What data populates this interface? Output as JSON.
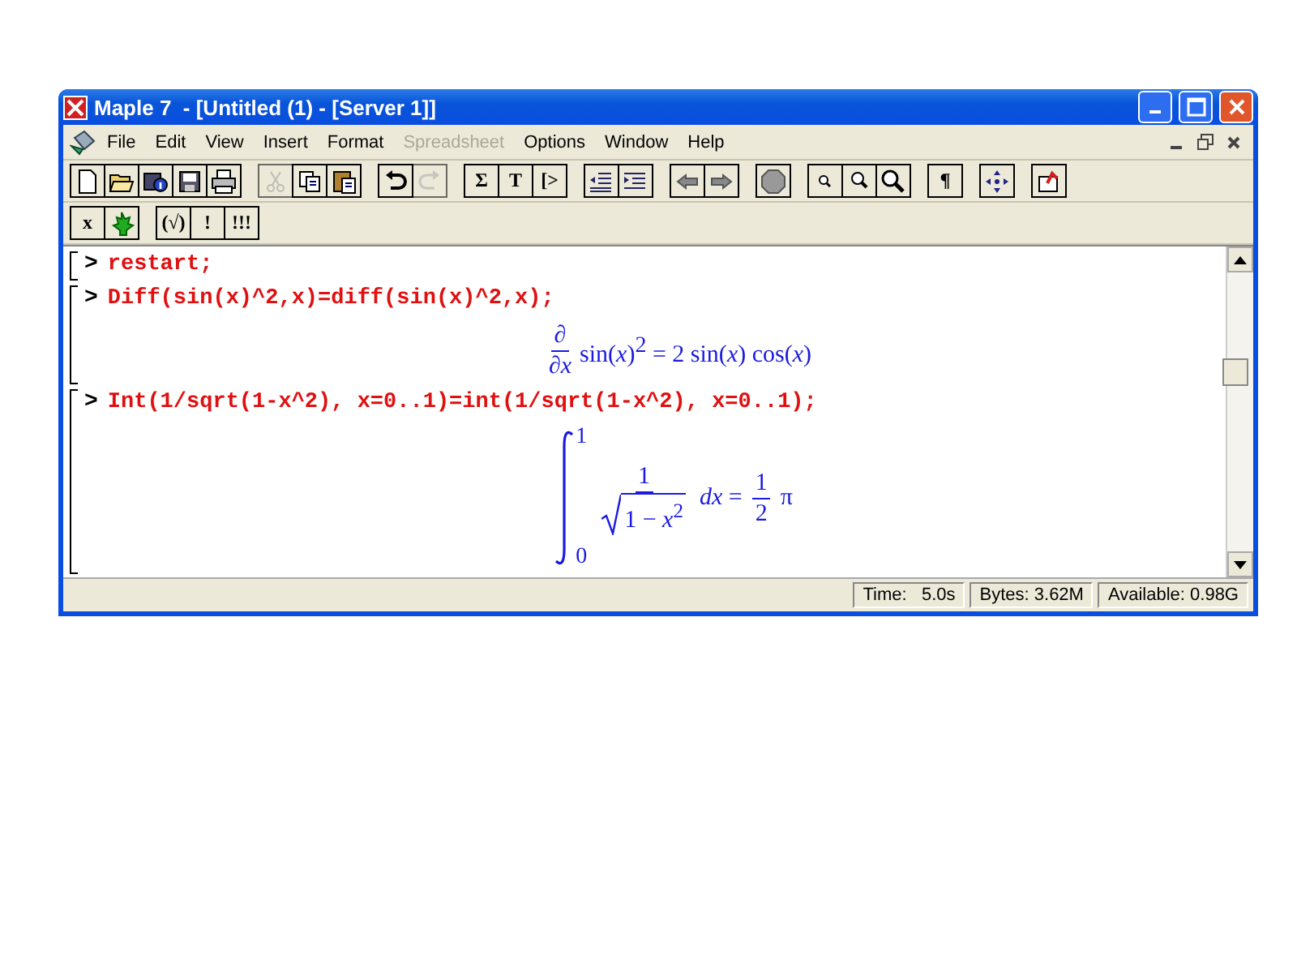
{
  "window": {
    "title": "Maple 7  - [Untitled (1) - [Server 1]]"
  },
  "menu": [
    {
      "label": "File",
      "disabled": false
    },
    {
      "label": "Edit",
      "disabled": false
    },
    {
      "label": "View",
      "disabled": false
    },
    {
      "label": "Insert",
      "disabled": false
    },
    {
      "label": "Format",
      "disabled": false
    },
    {
      "label": "Spreadsheet",
      "disabled": true
    },
    {
      "label": "Options",
      "disabled": false
    },
    {
      "label": "Window",
      "disabled": false
    },
    {
      "label": "Help",
      "disabled": false
    }
  ],
  "toolbar": [
    [
      {
        "disabled": false
      },
      {
        "disabled": false
      },
      {
        "disabled": false
      },
      {
        "disabled": false
      },
      {
        "disabled": false
      }
    ],
    [
      {
        "disabled": true
      },
      {
        "disabled": false
      },
      {
        "disabled": false
      }
    ],
    [
      {
        "disabled": false
      },
      {
        "disabled": true
      }
    ],
    [
      {
        "label": "Σ",
        "disabled": false
      },
      {
        "label": "T",
        "disabled": false
      },
      {
        "label": "[>",
        "disabled": false
      }
    ],
    [
      {
        "disabled": false
      },
      {
        "disabled": false
      }
    ],
    [
      {
        "disabled": false
      },
      {
        "disabled": false
      }
    ],
    [
      {
        "disabled": false
      }
    ],
    [
      {
        "disabled": false
      },
      {
        "disabled": false
      },
      {
        "disabled": false
      }
    ],
    [
      {
        "label": "¶",
        "disabled": false
      }
    ],
    [
      {
        "disabled": false
      }
    ],
    [
      {
        "disabled": false
      }
    ]
  ],
  "context_toolbar": [
    [
      {
        "label": "x",
        "disabled": false
      },
      {
        "disabled": false
      }
    ],
    [
      {
        "label": "(√)",
        "disabled": false
      },
      {
        "label": "!",
        "disabled": false
      },
      {
        "label": "!!!",
        "disabled": false
      }
    ]
  ],
  "worksheet": [
    {
      "prompt": ">",
      "input": "restart;"
    },
    {
      "prompt": ">",
      "input": "Diff(sin(x)^2,x)=diff(sin(x)^2,x);",
      "output": {
        "kind": "derivative",
        "numerator": "∂",
        "denominator": "∂*x*",
        "expression": "sin(*x*)$^{2}$ = 2 sin(*x*) cos(*x*)"
      }
    },
    {
      "prompt": ">",
      "input": "Int(1/sqrt(1-x^2), x=0..1)=int(1/sqrt(1-x^2), x=0..1);",
      "output": {
        "kind": "integral",
        "upper": "1",
        "lower": "0",
        "numerator": "1",
        "radicand": "1 − *x*$^{2}$",
        "differential": "*dx* =",
        "result_numerator": "1",
        "result_denominator": "2",
        "result_tail": "π"
      }
    }
  ],
  "status_bar": [
    "Time:   5.0s",
    "Bytes: 3.62M",
    "Available: 0.98G"
  ]
}
